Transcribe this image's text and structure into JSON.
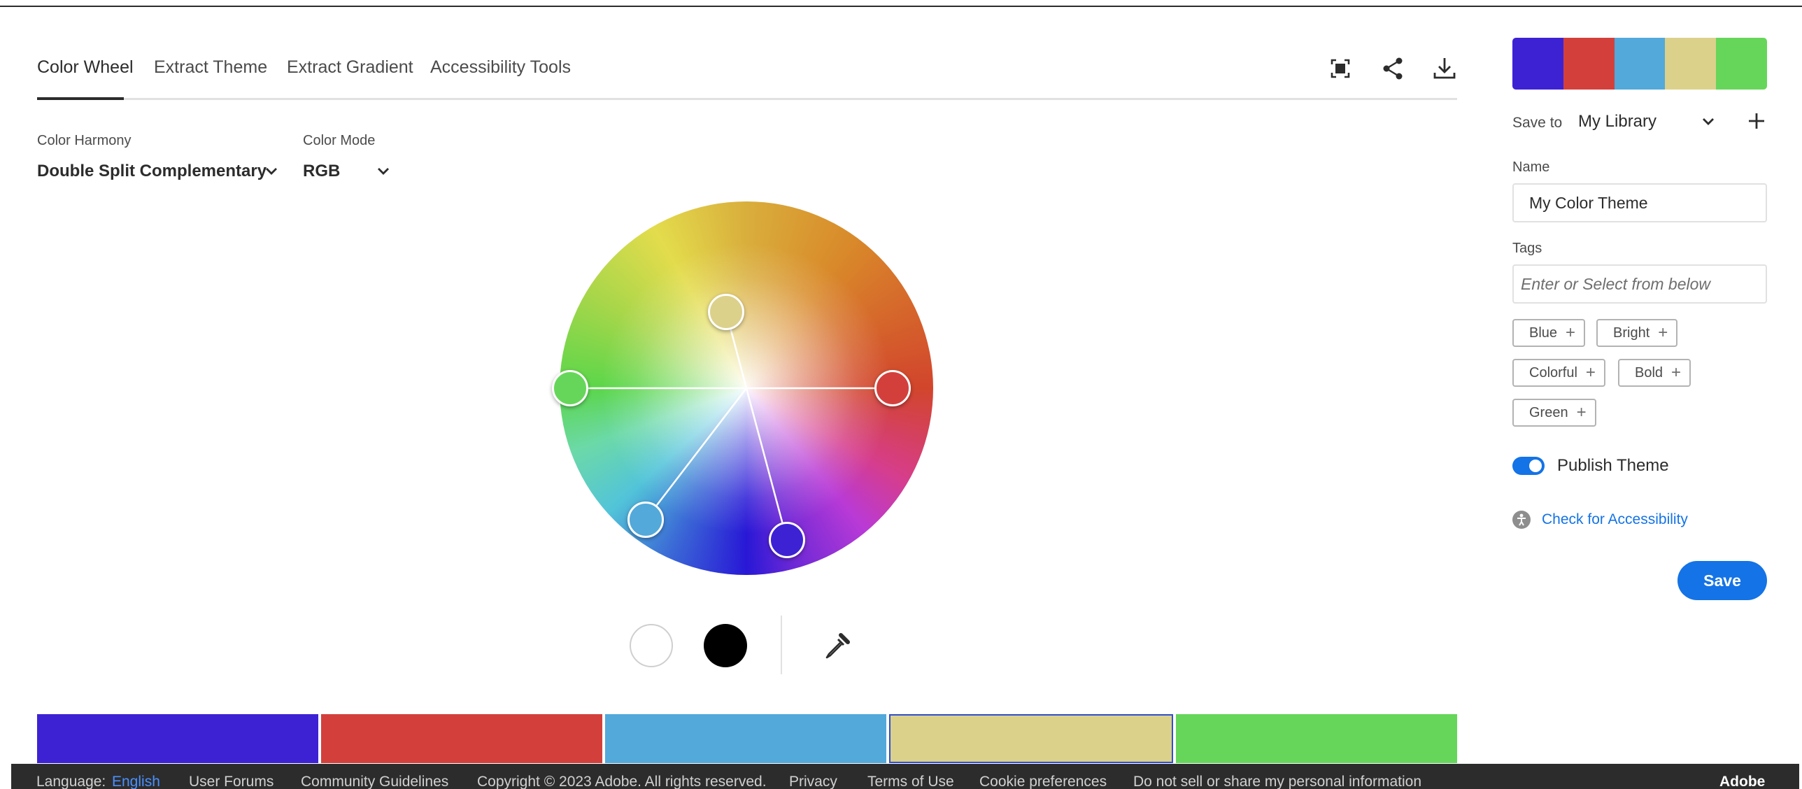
{
  "tabs": [
    {
      "label": "Color Wheel",
      "active": true
    },
    {
      "label": "Extract Theme",
      "active": false
    },
    {
      "label": "Extract Gradient",
      "active": false
    },
    {
      "label": "Accessibility Tools",
      "active": false
    }
  ],
  "toolbar_icons": [
    "fullscreen-icon",
    "share-icon",
    "download-icon"
  ],
  "controls": {
    "harmony_label": "Color Harmony",
    "harmony_value": "Double Split Complementary",
    "mode_label": "Color Mode",
    "mode_value": "RGB"
  },
  "wheel": {
    "base_handle_color": "#dbd18b",
    "handle_colors": [
      "#66d65a",
      "#dbd18b",
      "#d3403c",
      "#52a9da",
      "#3d22d4"
    ]
  },
  "picker_tools": {
    "white_color": "#ffffff",
    "black_color": "#000000",
    "eyedropper": "eyedropper-icon"
  },
  "swatches": [
    "#3d22d4",
    "#d3403c",
    "#52a9da",
    "#dbd18b",
    "#66d65a"
  ],
  "footer": {
    "language_label": "Language:",
    "language_value": "English",
    "links": [
      "User Forums",
      "Community Guidelines",
      "Copyright © 2023 Adobe. All rights reserved.",
      "Privacy",
      "Terms of Use",
      "Cookie preferences",
      "Do not sell or share my personal information"
    ],
    "brand": "Adobe"
  },
  "panel": {
    "theme_colors": [
      "#3d22d4",
      "#d3403c",
      "#52a9da",
      "#dbd18b",
      "#66d65a"
    ],
    "save_to_label": "Save to",
    "save_to_value": "My Library",
    "name_label": "Name",
    "name_value": "My Color Theme",
    "tags_label": "Tags",
    "tags_placeholder": "Enter or Select from below",
    "tags": [
      "Blue",
      "Bright",
      "Colorful",
      "Bold",
      "Green"
    ],
    "publish_label": "Publish Theme",
    "publish_on": true,
    "accessibility_link": "Check for Accessibility",
    "save_button": "Save"
  }
}
